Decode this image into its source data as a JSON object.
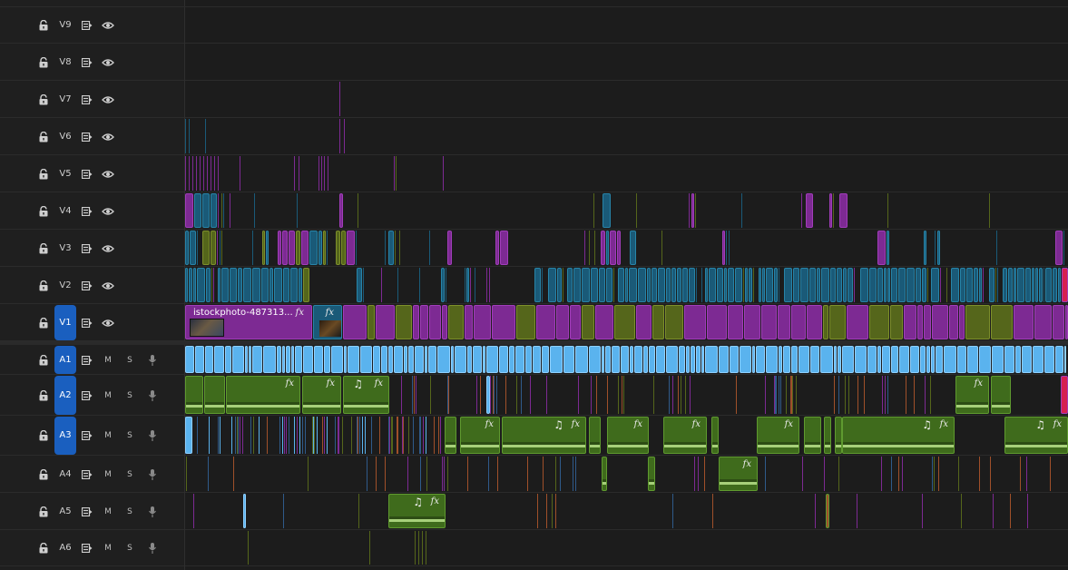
{
  "tracks": [
    {
      "id": "V9",
      "name": "V9",
      "kind": "video",
      "targeted": false
    },
    {
      "id": "V8",
      "name": "V8",
      "kind": "video",
      "targeted": false
    },
    {
      "id": "V7",
      "name": "V7",
      "kind": "video",
      "targeted": false
    },
    {
      "id": "V6",
      "name": "V6",
      "kind": "video",
      "targeted": false
    },
    {
      "id": "V5",
      "name": "V5",
      "kind": "video",
      "targeted": false
    },
    {
      "id": "V4",
      "name": "V4",
      "kind": "video",
      "targeted": false
    },
    {
      "id": "V3",
      "name": "V3",
      "kind": "video",
      "targeted": false
    },
    {
      "id": "V2",
      "name": "V2",
      "kind": "video",
      "targeted": false
    },
    {
      "id": "V1",
      "name": "V1",
      "kind": "video",
      "targeted": true
    },
    {
      "id": "A1",
      "name": "A1",
      "kind": "audio",
      "targeted": true
    },
    {
      "id": "A2",
      "name": "A2",
      "kind": "audio",
      "targeted": true
    },
    {
      "id": "A3",
      "name": "A3",
      "kind": "audio",
      "targeted": true
    },
    {
      "id": "A4",
      "name": "A4",
      "kind": "audio",
      "targeted": false
    },
    {
      "id": "A5",
      "name": "A5",
      "kind": "audio",
      "targeted": false
    },
    {
      "id": "A6",
      "name": "A6",
      "kind": "audio",
      "targeted": false
    }
  ],
  "audio_buttons": {
    "mute": "M",
    "solo": "S"
  },
  "icons": {
    "lock": "lock-icon",
    "sync": "sync-lock-icon",
    "eye": "eye-icon",
    "mic": "microphone-icon",
    "fx": "fx",
    "music": "♫"
  },
  "clips": {
    "v1_main_title": "istockphoto-487313...",
    "fx_label": "fx",
    "music_note": "♫"
  },
  "colors": {
    "targeted_blue": "#1a5fbf",
    "video_purple": "#7d2a93",
    "video_teal": "#1a5a78",
    "video_olive": "#55661b",
    "audio_blue": "#5ab3ee",
    "audio_green": "#3f6b1c",
    "marker_red": "#d62050"
  }
}
